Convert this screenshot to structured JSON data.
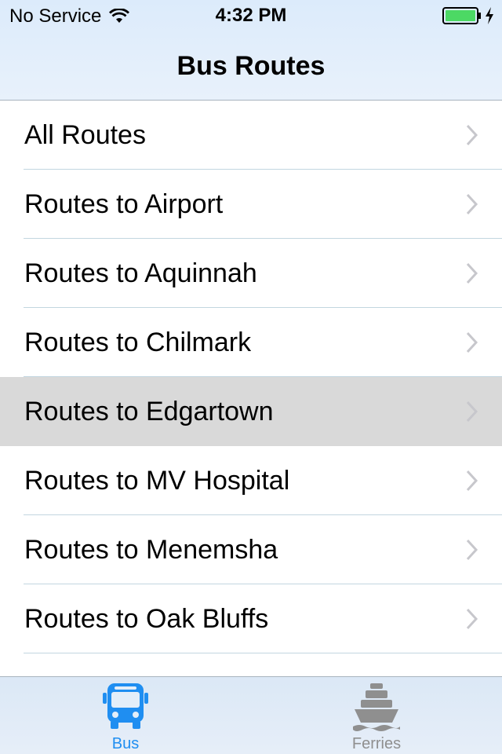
{
  "status_bar": {
    "carrier": "No Service",
    "time": "4:32 PM"
  },
  "nav": {
    "title": "Bus Routes"
  },
  "list": {
    "items": [
      {
        "label": "All Routes"
      },
      {
        "label": "Routes to Airport"
      },
      {
        "label": "Routes to Aquinnah"
      },
      {
        "label": "Routes to Chilmark"
      },
      {
        "label": "Routes to Edgartown",
        "selected": true
      },
      {
        "label": "Routes to MV Hospital"
      },
      {
        "label": "Routes to Menemsha"
      },
      {
        "label": "Routes to Oak Bluffs"
      },
      {
        "label": ""
      }
    ]
  },
  "tabs": [
    {
      "label": "Bus",
      "icon": "bus-icon",
      "active": true
    },
    {
      "label": "Ferries",
      "icon": "ferry-icon",
      "active": false
    }
  ],
  "colors": {
    "accent": "#1f8ef1",
    "inactive_tab": "#8f8f8f",
    "selected_row": "#d9d9d9",
    "battery": "#4cd964"
  }
}
